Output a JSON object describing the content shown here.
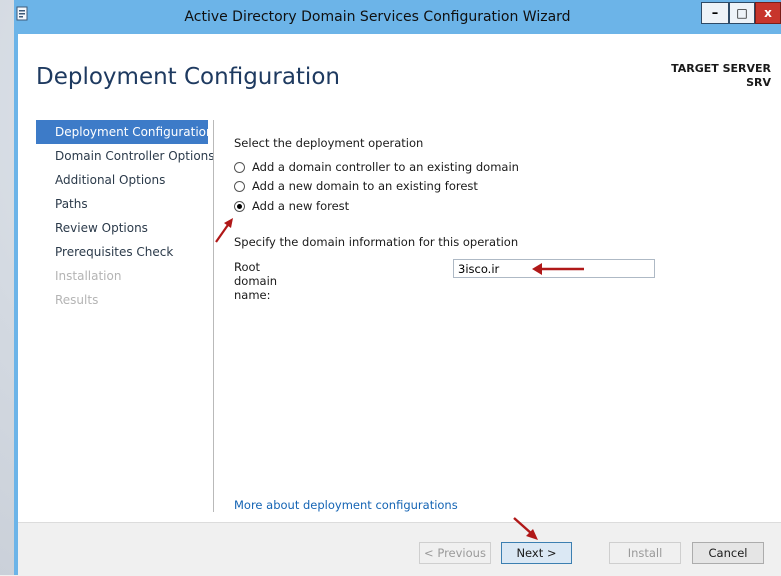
{
  "window": {
    "title": "Active Directory Domain Services Configuration Wizard",
    "min_symbol": "–",
    "max_symbol": "□",
    "close_symbol": "x"
  },
  "header": {
    "page_title": "Deployment Configuration",
    "target_label": "TARGET SERVER",
    "target_name": "SRV"
  },
  "nav": {
    "items": [
      {
        "label": "Deployment Configuration",
        "state": "active"
      },
      {
        "label": "Domain Controller Options",
        "state": "normal"
      },
      {
        "label": "Additional Options",
        "state": "normal"
      },
      {
        "label": "Paths",
        "state": "normal"
      },
      {
        "label": "Review Options",
        "state": "normal"
      },
      {
        "label": "Prerequisites Check",
        "state": "normal"
      },
      {
        "label": "Installation",
        "state": "disabled"
      },
      {
        "label": "Results",
        "state": "disabled"
      }
    ]
  },
  "main": {
    "operation_heading": "Select the deployment operation",
    "options": [
      {
        "label": "Add a domain controller to an existing domain",
        "selected": false
      },
      {
        "label": "Add a new domain to an existing forest",
        "selected": false
      },
      {
        "label": "Add a new forest",
        "selected": true
      }
    ],
    "domain_heading": "Specify the domain information for this operation",
    "root_domain_label": "Root domain name:",
    "root_domain_value": "3isco.ir",
    "more_link": "More about deployment configurations"
  },
  "footer": {
    "previous_label": "< Previous",
    "next_label": "Next >",
    "install_label": "Install",
    "cancel_label": "Cancel"
  },
  "colors": {
    "titlebar": "#6cb4e8",
    "active_nav": "#3d7bc8",
    "heading": "#1e3a60",
    "link": "#1464b4",
    "annotation_arrow": "#b01818",
    "close_button": "#c7352c"
  }
}
